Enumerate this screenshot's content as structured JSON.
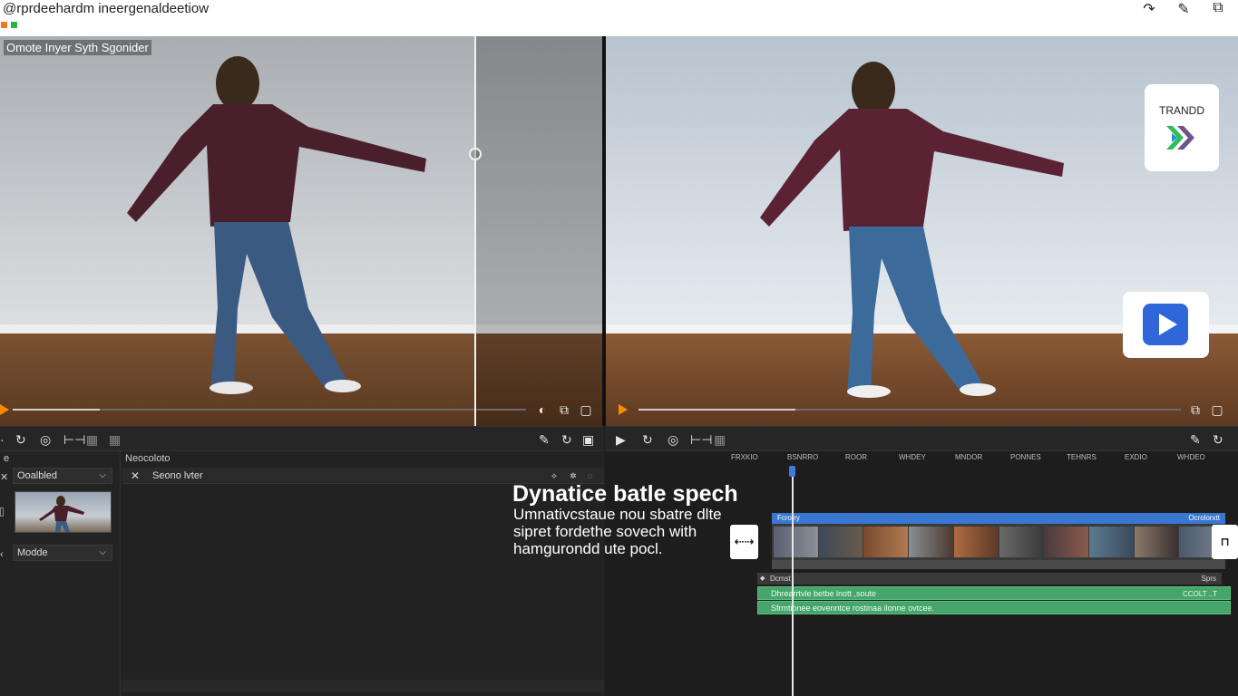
{
  "window": {
    "title": "@rprdeehardm ineergenaldeetiow",
    "tools": [
      "redo-icon",
      "pen-icon",
      "share-icon"
    ]
  },
  "preview_left": {
    "label": "Omote Inyer Syth Sgonider",
    "progress": 0.17
  },
  "preview_right": {
    "progress": 0.29,
    "brand_card_label": "TRANDD"
  },
  "left_panel": {
    "header_col1": "e",
    "header_col2": "Neocoloto",
    "select_top": "Ooalbled",
    "select_bottom": "Modde",
    "search_row_label": "Seono lvter"
  },
  "timeline": {
    "ruler": [
      "FRXKIO",
      "BSNRRO",
      "ROOR",
      "WHDEY",
      "MNDOR",
      "PONNES",
      "TEHNRS",
      "EXDIO",
      "WHDEO"
    ],
    "video_track_label": "Fcrotry",
    "video_track_right": "Ocrolorxtt",
    "audio_head_label": "Dcmst",
    "audio_head_right": "Sprs",
    "audio_track_1": "Dhrearrtvle  betbe  lnott  ,soute",
    "audio_track_1_right": "CCOLT ..T",
    "audio_track_2": "Sfrmtionee eovenntce rostinaa ilonne ovtcee."
  },
  "overlay": {
    "title": "Dynatice batle spech",
    "body": "Umnativcstaue nou sbatre dlte sipret fordethe sovech with hamgurondd ute pocl."
  },
  "colors": {
    "accent_orange": "#ff8a00",
    "accent_blue": "#3977d0",
    "audio_green": "#46a56b",
    "play_blue": "#2f66d8"
  }
}
